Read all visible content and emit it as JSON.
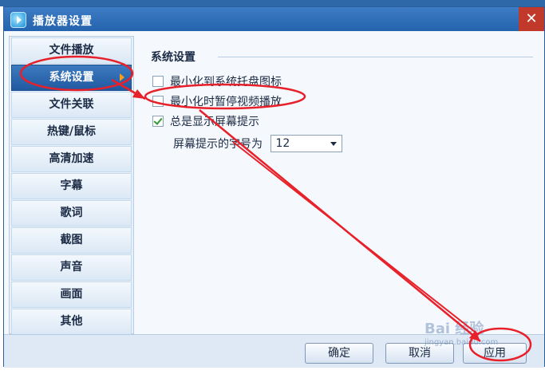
{
  "dialog": {
    "title": "播放器设置",
    "close_symbol": "✕"
  },
  "sidebar": {
    "items": [
      {
        "label": "文件播放",
        "active": false
      },
      {
        "label": "系统设置",
        "active": true
      },
      {
        "label": "文件关联",
        "active": false
      },
      {
        "label": "热键/鼠标",
        "active": false
      },
      {
        "label": "高清加速",
        "active": false
      },
      {
        "label": "字幕",
        "active": false
      },
      {
        "label": "歌词",
        "active": false
      },
      {
        "label": "截图",
        "active": false
      },
      {
        "label": "声音",
        "active": false
      },
      {
        "label": "画面",
        "active": false
      },
      {
        "label": "其他",
        "active": false
      }
    ]
  },
  "content": {
    "section_title": "系统设置",
    "options": [
      {
        "label": "最小化到系统托盘图标",
        "checked": false
      },
      {
        "label": "最小化时暂停视频播放",
        "checked": false
      },
      {
        "label": "总是显示屏幕提示",
        "checked": true
      }
    ],
    "font_size": {
      "label": "屏幕提示的字号为",
      "value": "12"
    }
  },
  "footer": {
    "ok_label": "确定",
    "cancel_label": "取消",
    "apply_label": "应用"
  },
  "watermark": {
    "main": "Bai 经验",
    "url": "jingyan.baidu.com"
  },
  "colors": {
    "annotation": "#e8202a",
    "active_nav": "#2d66b0",
    "arrow": "#ff9b1a"
  }
}
